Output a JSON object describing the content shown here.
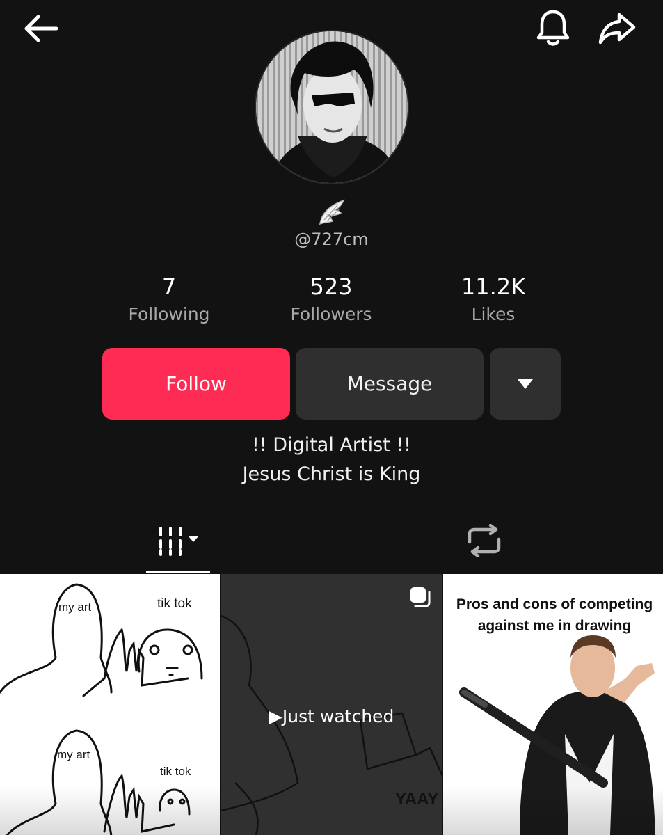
{
  "header": {
    "back_icon": "arrow-left-icon",
    "notification_icon": "bell-icon",
    "share_icon": "share-arrow-icon"
  },
  "profile": {
    "avatar_icon": "avatar-photo",
    "badge_icon": "wing-emoji-icon",
    "username": "@727cm"
  },
  "stats": [
    {
      "value": "7",
      "label": "Following"
    },
    {
      "value": "523",
      "label": "Followers"
    },
    {
      "value": "11.2K",
      "label": "Likes"
    }
  ],
  "actions": {
    "follow_label": "Follow",
    "message_label": "Message",
    "more_icon": "caret-down-icon"
  },
  "bio": {
    "line1": "!! Digital Artist !!",
    "line2": "Jesus Christ is King"
  },
  "tabs": {
    "videos_icon": "grid-dropdown-icon",
    "reposts_icon": "repost-icon"
  },
  "videos": [
    {
      "text_a": "my art",
      "text_b": "tik tok",
      "text_c": "my art",
      "text_d": "tik tok"
    },
    {
      "overlay": "Just watched",
      "corner_text": "YAAY",
      "multi_icon": "multiple-posts-icon"
    },
    {
      "caption": "Pros and cons of competing against me in drawing"
    }
  ],
  "colors": {
    "background": "#121212",
    "follow": "#fe2c55",
    "secondary_button": "#2f2f2f",
    "muted_text": "#a8a8a8"
  }
}
